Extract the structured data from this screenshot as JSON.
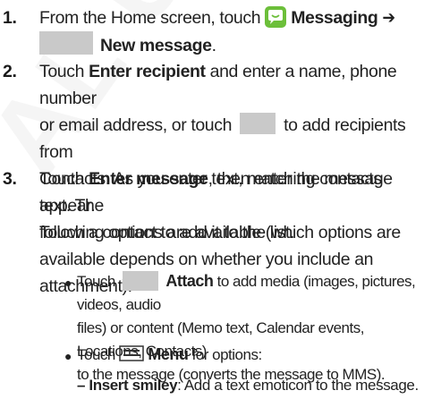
{
  "watermark": "AL USE",
  "steps": [
    {
      "num": "1.",
      "line1_pre": "From the Home screen, touch",
      "line1_kw": "Messaging",
      "arrow": "➔",
      "line2_kw": "New message",
      "line2_end": "."
    },
    {
      "num": "2.",
      "pre": "Touch",
      "kw": "Enter recipient",
      "l1_rest": "and enter a name, phone number",
      "l2_a": "or email address, or touch",
      "l2_b": "to add recipients from",
      "l3": "Contacts. As you enter text, matching contacts appear.",
      "l4": "Touch a contact to add it to the list."
    },
    {
      "num": "3.",
      "pre": "Touch",
      "kw": "Enter message",
      "l1_rest": ", then enter the message text. The",
      "l2": "following options are available (which options are",
      "l3": "available depends on whether you include an",
      "l4": "attachment):"
    }
  ],
  "bullets": [
    {
      "pre": "Touch",
      "kw": "Attach",
      "l1_rest": "to add media (images, pictures, videos, audio",
      "l2": "files) or content (Memo text, Calendar events, Locations, Contacts)",
      "l3": "to the message (converts the message to MMS)."
    },
    {
      "pre": "Touch",
      "kw": "Menu",
      "l1_rest": "for options:"
    }
  ],
  "sub_options": [
    {
      "dash": "–",
      "kw": "Insert smiley",
      "rest": ": Add a text emoticon to the message."
    }
  ],
  "icons": {
    "messaging": "messaging-app-icon",
    "new_message": "new-message-icon",
    "contacts": "contacts-icon",
    "attach": "attach-icon",
    "menu": "menu-icon"
  },
  "colors": {
    "messaging_icon": "#6cbf3a",
    "placeholder_icon": "#c9c9c9"
  }
}
